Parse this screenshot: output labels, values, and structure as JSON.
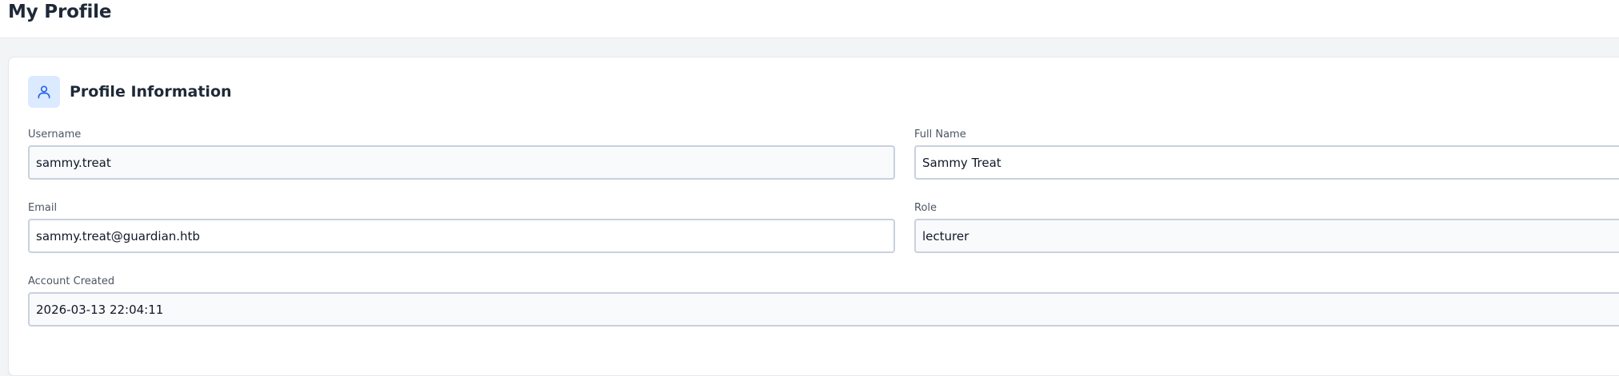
{
  "header": {
    "title": "My Profile"
  },
  "profile_card": {
    "title": "Profile Information",
    "icon": "user-icon",
    "accent_color": "#2563eb",
    "icon_background": "#dbeafe",
    "fields": {
      "username": {
        "label": "Username",
        "value": "sammy.treat"
      },
      "full_name": {
        "label": "Full Name",
        "value": "Sammy Treat"
      },
      "email": {
        "label": "Email",
        "value": "sammy.treat@guardian.htb"
      },
      "role": {
        "label": "Role",
        "value": "lecturer"
      },
      "account_created": {
        "label": "Account Created",
        "value": "2026-03-13 22:04:11"
      }
    }
  }
}
